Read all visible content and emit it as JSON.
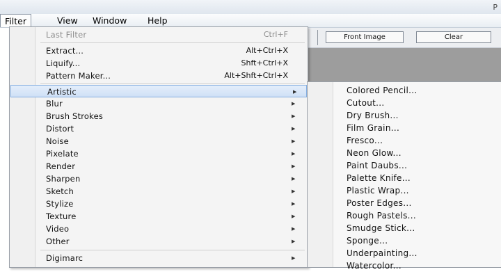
{
  "window": {
    "title_fragment": "P"
  },
  "menubar": {
    "items": [
      {
        "label": "Filter",
        "active": true
      },
      {
        "label": "View"
      },
      {
        "label": "Window"
      },
      {
        "label": "Help"
      }
    ]
  },
  "options_bar": {
    "front_image_label": "Front Image",
    "clear_label": "Clear"
  },
  "filter_menu": {
    "last_filter": {
      "label": "Last Filter",
      "shortcut": "Ctrl+F"
    },
    "extract": {
      "label": "Extract...",
      "shortcut": "Alt+Ctrl+X"
    },
    "liquify": {
      "label": "Liquify...",
      "shortcut": "Shft+Ctrl+X"
    },
    "pattern_maker": {
      "label": "Pattern Maker...",
      "shortcut": "Alt+Shft+Ctrl+X"
    },
    "submenus": [
      "Artistic",
      "Blur",
      "Brush Strokes",
      "Distort",
      "Noise",
      "Pixelate",
      "Render",
      "Sharpen",
      "Sketch",
      "Stylize",
      "Texture",
      "Video",
      "Other"
    ],
    "digimarc": "Digimarc",
    "arrow_glyph": "▶"
  },
  "artistic_submenu": {
    "items": [
      "Colored Pencil...",
      "Cutout...",
      "Dry Brush...",
      "Film Grain...",
      "Fresco...",
      "Neon Glow...",
      "Paint Daubs...",
      "Palette Knife...",
      "Plastic Wrap...",
      "Poster Edges...",
      "Rough Pastels...",
      "Smudge Stick...",
      "Sponge...",
      "Underpainting...",
      "Watercolor..."
    ]
  },
  "colors": {
    "highlight": "#cfe0f6",
    "menu_bg": "#f4f4f4",
    "disabled_text": "#8c8c8c"
  }
}
